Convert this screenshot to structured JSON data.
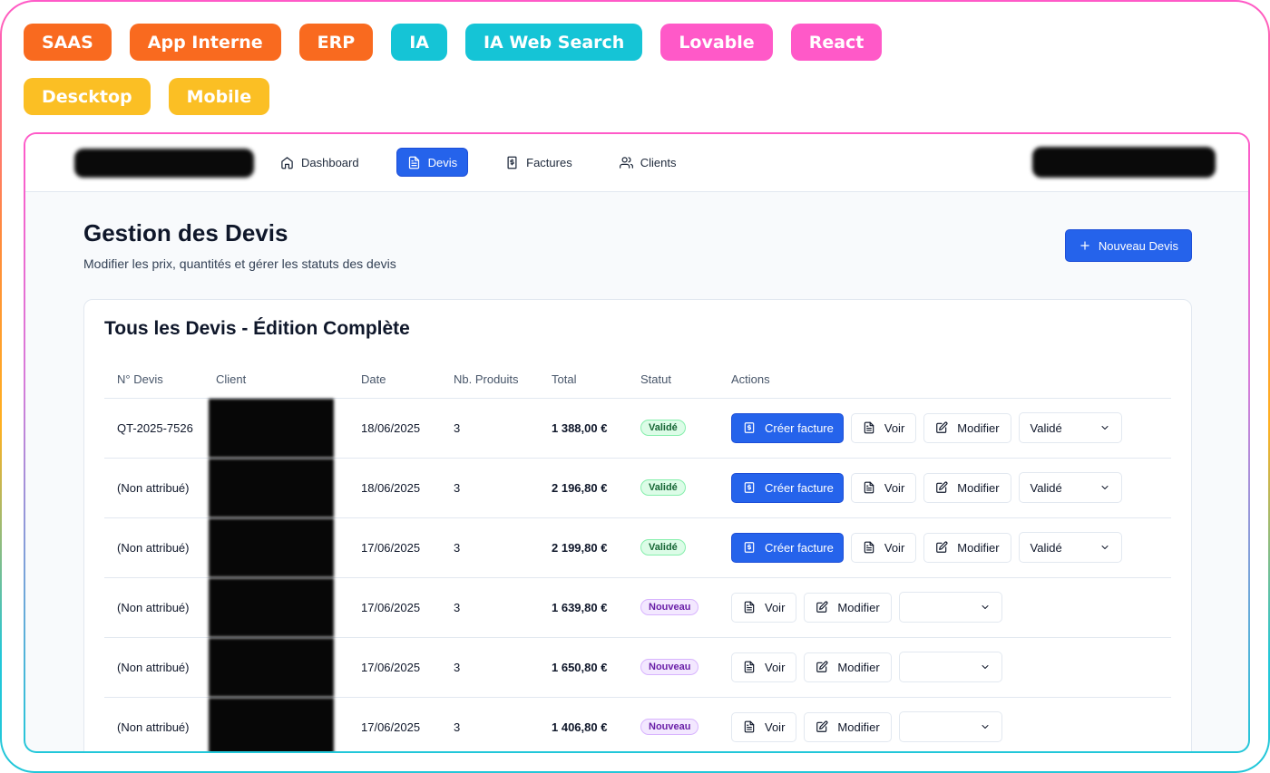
{
  "tags": {
    "row1": [
      {
        "label": "SAAS",
        "color": "orange"
      },
      {
        "label": "App Interne",
        "color": "orange"
      },
      {
        "label": "ERP",
        "color": "orange"
      },
      {
        "label": "IA",
        "color": "cyan"
      },
      {
        "label": "IA Web Search",
        "color": "cyan"
      },
      {
        "label": "Lovable",
        "color": "pink"
      },
      {
        "label": "React",
        "color": "pink"
      }
    ],
    "row2": [
      {
        "label": "Descktop",
        "color": "yellow"
      },
      {
        "label": "Mobile",
        "color": "yellow"
      }
    ]
  },
  "nav": {
    "items": [
      {
        "label": "Dashboard",
        "icon": "home-icon",
        "active": false
      },
      {
        "label": "Devis",
        "icon": "file-text-icon",
        "active": true
      },
      {
        "label": "Factures",
        "icon": "receipt-dollar-icon",
        "active": false
      },
      {
        "label": "Clients",
        "icon": "users-icon",
        "active": false
      }
    ]
  },
  "page": {
    "title": "Gestion des Devis",
    "subtitle": "Modifier les prix, quantités et gérer les statuts des devis",
    "new_button": "Nouveau Devis"
  },
  "card": {
    "title": "Tous les Devis - Édition Complète",
    "columns": [
      "N° Devis",
      "Client",
      "Date",
      "Nb. Produits",
      "Total",
      "Statut",
      "Actions"
    ],
    "rows": [
      {
        "num": "QT-2025-7526",
        "date": "18/06/2025",
        "products": "3",
        "total": "1 388,00 €",
        "status": "Validé",
        "status_type": "valide",
        "select": "Validé"
      },
      {
        "num": "(Non attribué)",
        "date": "18/06/2025",
        "products": "3",
        "total": "2 196,80 €",
        "status": "Validé",
        "status_type": "valide",
        "select": "Validé"
      },
      {
        "num": "(Non attribué)",
        "date": "17/06/2025",
        "products": "3",
        "total": "2 199,80 €",
        "status": "Validé",
        "status_type": "valide",
        "select": "Validé"
      },
      {
        "num": "(Non attribué)",
        "date": "17/06/2025",
        "products": "3",
        "total": "1 639,80 €",
        "status": "Nouveau",
        "status_type": "nouveau",
        "select": ""
      },
      {
        "num": "(Non attribué)",
        "date": "17/06/2025",
        "products": "3",
        "total": "1 650,80 €",
        "status": "Nouveau",
        "status_type": "nouveau",
        "select": ""
      },
      {
        "num": "(Non attribué)",
        "date": "17/06/2025",
        "products": "3",
        "total": "1 406,80 €",
        "status": "Nouveau",
        "status_type": "nouveau",
        "select": ""
      }
    ],
    "actions": {
      "create_invoice": "Créer facture",
      "view": "Voir",
      "edit": "Modifier"
    }
  },
  "colors": {
    "primary": "#2563eb",
    "orange_tag": "#f96a1f",
    "cyan_tag": "#15c4d6",
    "pink_tag": "#ff59c8",
    "yellow_tag": "#fbbf24"
  }
}
